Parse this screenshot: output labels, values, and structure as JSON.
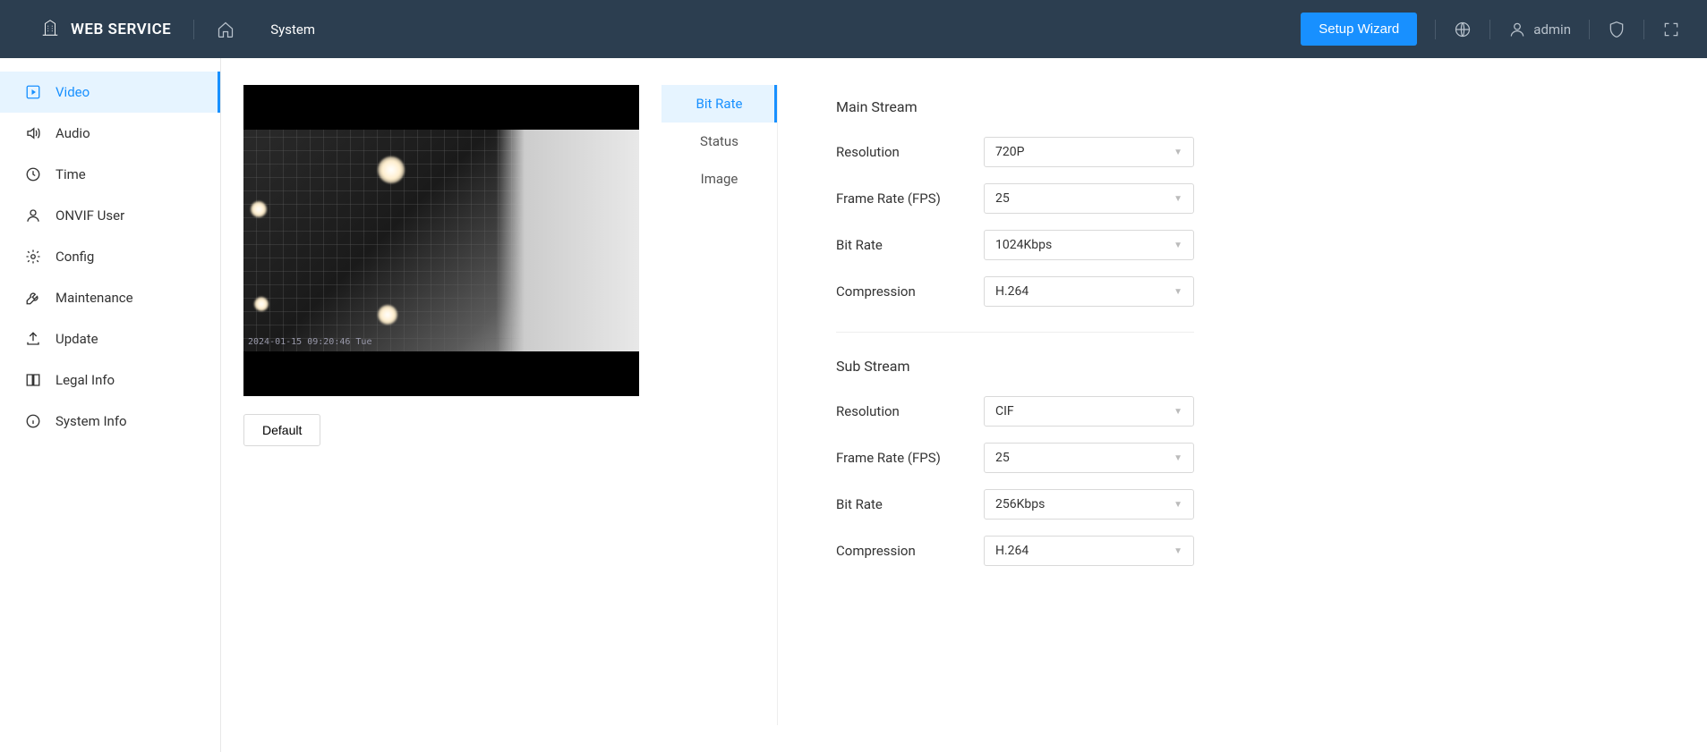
{
  "header": {
    "title": "WEB SERVICE",
    "nav_item": "System",
    "setup_wizard": "Setup Wizard",
    "username": "admin"
  },
  "sidebar": {
    "items": [
      {
        "label": "Video"
      },
      {
        "label": "Audio"
      },
      {
        "label": "Time"
      },
      {
        "label": "ONVIF User"
      },
      {
        "label": "Config"
      },
      {
        "label": "Maintenance"
      },
      {
        "label": "Update"
      },
      {
        "label": "Legal Info"
      },
      {
        "label": "System Info"
      }
    ]
  },
  "preview": {
    "timestamp": "2024-01-15 09:20:46 Tue",
    "default_btn": "Default"
  },
  "tabs": {
    "items": [
      {
        "label": "Bit Rate"
      },
      {
        "label": "Status"
      },
      {
        "label": "Image"
      }
    ]
  },
  "form": {
    "main_stream": {
      "title": "Main Stream",
      "resolution_label": "Resolution",
      "resolution_value": "720P",
      "fps_label": "Frame Rate (FPS)",
      "fps_value": "25",
      "bitrate_label": "Bit Rate",
      "bitrate_value": "1024Kbps",
      "compression_label": "Compression",
      "compression_value": "H.264"
    },
    "sub_stream": {
      "title": "Sub Stream",
      "resolution_label": "Resolution",
      "resolution_value": "CIF",
      "fps_label": "Frame Rate (FPS)",
      "fps_value": "25",
      "bitrate_label": "Bit Rate",
      "bitrate_value": "256Kbps",
      "compression_label": "Compression",
      "compression_value": "H.264"
    }
  }
}
